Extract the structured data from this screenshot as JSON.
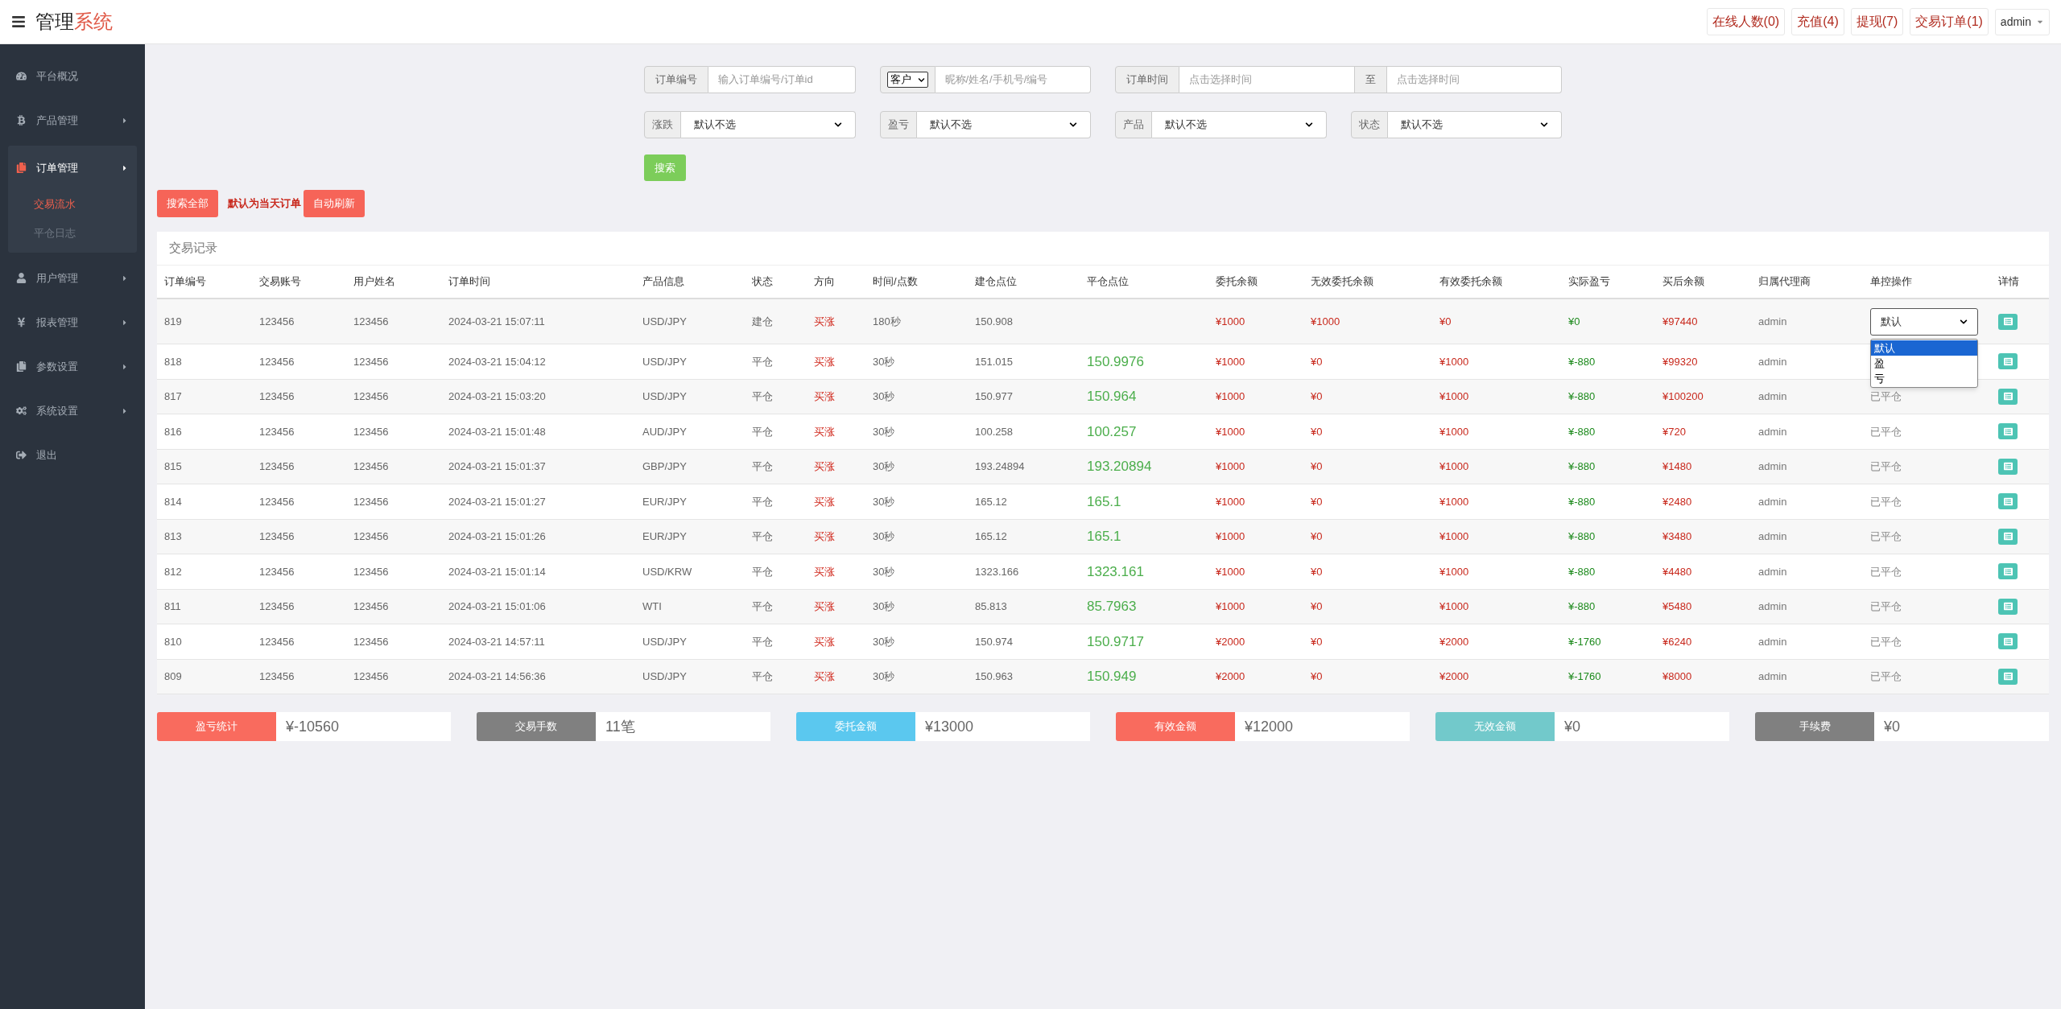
{
  "header": {
    "title_main": "管理",
    "title_accent": "系统",
    "links": [
      "在线人数(0)",
      "充值(4)",
      "提现(7)",
      "交易订单(1)"
    ],
    "user": "admin"
  },
  "sidebar": {
    "items": [
      {
        "label": "平台概况",
        "arrow": false,
        "expanded": false
      },
      {
        "label": "产品管理",
        "arrow": true,
        "expanded": false
      },
      {
        "label": "订单管理",
        "arrow": true,
        "expanded": true,
        "children": [
          {
            "label": "交易流水",
            "selected": true
          },
          {
            "label": "平仓日志",
            "selected": false
          }
        ]
      },
      {
        "label": "用户管理",
        "arrow": true,
        "expanded": false
      },
      {
        "label": "报表管理",
        "arrow": true,
        "expanded": false
      },
      {
        "label": "参数设置",
        "arrow": true,
        "expanded": false
      },
      {
        "label": "系统设置",
        "arrow": true,
        "expanded": false
      },
      {
        "label": "退出",
        "arrow": false,
        "expanded": false
      }
    ]
  },
  "filters": [
    {
      "kind": "text",
      "label": "订单编号",
      "placeholder": "输入订单编号/订单id"
    },
    {
      "kind": "select_text",
      "select_value": "客户",
      "placeholder": "昵称/姓名/手机号/编号"
    },
    {
      "kind": "range",
      "label": "订单时间",
      "placeholder": "点击选择时间",
      "separator": "至",
      "placeholder_end": "点击选择时间"
    }
  ],
  "selects": [
    {
      "label": "涨跌",
      "value": "默认不选"
    },
    {
      "label": "盈亏",
      "value": "默认不选"
    },
    {
      "label": "产品",
      "value": "默认不选"
    },
    {
      "label": "状态",
      "value": "默认不选"
    }
  ],
  "search_button": "搜索",
  "toolbar": {
    "search_all": "搜索全部",
    "note": "默认为当天订单",
    "auto_refresh": "自动刷新"
  },
  "table": {
    "title": "交易记录",
    "columns": [
      "订单编号",
      "交易账号",
      "用户姓名",
      "订单时间",
      "产品信息",
      "状态",
      "方向",
      "时间/点数",
      "建仓点位",
      "平仓点位",
      "委托余额",
      "无效委托余额",
      "有效委托余额",
      "实际盈亏",
      "买后余额",
      "归属代理商",
      "单控操作",
      "详情"
    ],
    "rows": [
      {
        "order_no": "819",
        "account": "123456",
        "user": "123456",
        "time": "2024-03-21 15:07:11",
        "product": "USD/JPY",
        "status": "建仓",
        "direction": "买涨",
        "duration": "180秒",
        "open_price": "150.908",
        "entrust": "¥1000",
        "invalid_entrust": "¥1000",
        "valid_entrust": "¥0",
        "pnl": "¥0",
        "balance": "¥97440",
        "agent": "admin",
        "control": {
          "kind": "select",
          "value": "默认",
          "open": true,
          "options": [
            {
              "label": "默认",
              "selected": true
            },
            {
              "label": "盈",
              "selected": false
            },
            {
              "label": "亏",
              "selected": false
            }
          ]
        }
      },
      {
        "order_no": "818",
        "account": "123456",
        "user": "123456",
        "time": "2024-03-21 15:04:12",
        "product": "USD/JPY",
        "status": "平仓",
        "direction": "买涨",
        "duration": "30秒",
        "open_price": "151.015",
        "close_price": "150.9976",
        "entrust": "¥1000",
        "invalid_entrust": "¥0",
        "valid_entrust": "¥1000",
        "pnl": "¥-880",
        "balance": "¥99320",
        "agent": "admin"
      },
      {
        "order_no": "817",
        "account": "123456",
        "user": "123456",
        "time": "2024-03-21 15:03:20",
        "product": "USD/JPY",
        "status": "平仓",
        "direction": "买涨",
        "duration": "30秒",
        "open_price": "150.977",
        "close_price": "150.964",
        "entrust": "¥1000",
        "invalid_entrust": "¥0",
        "valid_entrust": "¥1000",
        "pnl": "¥-880",
        "balance": "¥100200",
        "agent": "admin",
        "control": {
          "kind": "text",
          "value": "已平仓"
        }
      },
      {
        "order_no": "816",
        "account": "123456",
        "user": "123456",
        "time": "2024-03-21 15:01:48",
        "product": "AUD/JPY",
        "status": "平仓",
        "direction": "买涨",
        "duration": "30秒",
        "open_price": "100.258",
        "close_price": "100.257",
        "entrust": "¥1000",
        "invalid_entrust": "¥0",
        "valid_entrust": "¥1000",
        "pnl": "¥-880",
        "balance": "¥720",
        "agent": "admin",
        "control": {
          "kind": "text",
          "value": "已平仓"
        }
      },
      {
        "order_no": "815",
        "account": "123456",
        "user": "123456",
        "time": "2024-03-21 15:01:37",
        "product": "GBP/JPY",
        "status": "平仓",
        "direction": "买涨",
        "duration": "30秒",
        "open_price": "193.24894",
        "close_price": "193.20894",
        "entrust": "¥1000",
        "invalid_entrust": "¥0",
        "valid_entrust": "¥1000",
        "pnl": "¥-880",
        "balance": "¥1480",
        "agent": "admin",
        "control": {
          "kind": "text",
          "value": "已平仓"
        }
      },
      {
        "order_no": "814",
        "account": "123456",
        "user": "123456",
        "time": "2024-03-21 15:01:27",
        "product": "EUR/JPY",
        "status": "平仓",
        "direction": "买涨",
        "duration": "30秒",
        "open_price": "165.12",
        "close_price": "165.1",
        "entrust": "¥1000",
        "invalid_entrust": "¥0",
        "valid_entrust": "¥1000",
        "pnl": "¥-880",
        "balance": "¥2480",
        "agent": "admin",
        "control": {
          "kind": "text",
          "value": "已平仓"
        }
      },
      {
        "order_no": "813",
        "account": "123456",
        "user": "123456",
        "time": "2024-03-21 15:01:26",
        "product": "EUR/JPY",
        "status": "平仓",
        "direction": "买涨",
        "duration": "30秒",
        "open_price": "165.12",
        "close_price": "165.1",
        "entrust": "¥1000",
        "invalid_entrust": "¥0",
        "valid_entrust": "¥1000",
        "pnl": "¥-880",
        "balance": "¥3480",
        "agent": "admin",
        "control": {
          "kind": "text",
          "value": "已平仓"
        }
      },
      {
        "order_no": "812",
        "account": "123456",
        "user": "123456",
        "time": "2024-03-21 15:01:14",
        "product": "USD/KRW",
        "status": "平仓",
        "direction": "买涨",
        "duration": "30秒",
        "open_price": "1323.166",
        "close_price": "1323.161",
        "entrust": "¥1000",
        "invalid_entrust": "¥0",
        "valid_entrust": "¥1000",
        "pnl": "¥-880",
        "balance": "¥4480",
        "agent": "admin",
        "control": {
          "kind": "text",
          "value": "已平仓"
        }
      },
      {
        "order_no": "811",
        "account": "123456",
        "user": "123456",
        "time": "2024-03-21 15:01:06",
        "product": "WTI",
        "status": "平仓",
        "direction": "买涨",
        "duration": "30秒",
        "open_price": "85.813",
        "close_price": "85.7963",
        "entrust": "¥1000",
        "invalid_entrust": "¥0",
        "valid_entrust": "¥1000",
        "pnl": "¥-880",
        "balance": "¥5480",
        "agent": "admin",
        "control": {
          "kind": "text",
          "value": "已平仓"
        }
      },
      {
        "order_no": "810",
        "account": "123456",
        "user": "123456",
        "time": "2024-03-21 14:57:11",
        "product": "USD/JPY",
        "status": "平仓",
        "direction": "买涨",
        "duration": "30秒",
        "open_price": "150.974",
        "close_price": "150.9717",
        "entrust": "¥2000",
        "invalid_entrust": "¥0",
        "valid_entrust": "¥2000",
        "pnl": "¥-1760",
        "balance": "¥6240",
        "agent": "admin",
        "control": {
          "kind": "text",
          "value": "已平仓"
        }
      },
      {
        "order_no": "809",
        "account": "123456",
        "user": "123456",
        "time": "2024-03-21 14:56:36",
        "product": "USD/JPY",
        "status": "平仓",
        "direction": "买涨",
        "duration": "30秒",
        "open_price": "150.963",
        "close_price": "150.949",
        "entrust": "¥2000",
        "invalid_entrust": "¥0",
        "valid_entrust": "¥2000",
        "pnl": "¥-1760",
        "balance": "¥8000",
        "agent": "admin",
        "control": {
          "kind": "text",
          "value": "已平仓"
        }
      }
    ]
  },
  "stats": [
    {
      "label": "盈亏统计",
      "value": "¥-10560",
      "color": "#f96b5e"
    },
    {
      "label": "交易手数",
      "value": "11笔",
      "color": "#808080"
    },
    {
      "label": "委托金额",
      "value": "¥13000",
      "color": "#5bc8ef"
    },
    {
      "label": "有效金额",
      "value": "¥12000",
      "color": "#f96b5e"
    },
    {
      "label": "无效金额",
      "value": "¥0",
      "color": "#72c9cb"
    },
    {
      "label": "手续费",
      "value": "¥0",
      "color": "#808080"
    }
  ]
}
